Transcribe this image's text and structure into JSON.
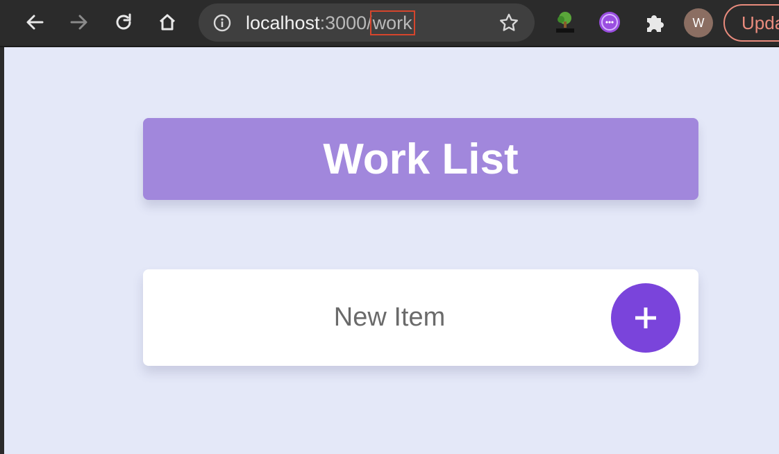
{
  "browser": {
    "url_host": "localhost",
    "url_port": ":3000/",
    "url_path": "work",
    "avatar_letter": "W",
    "update_label": "Update",
    "accent_color": "#e98b7d"
  },
  "page": {
    "title": "Work List",
    "new_item_placeholder": "New Item",
    "add_button_label": "+",
    "header_color": "#a187dc",
    "button_color": "#7a44db",
    "background_color": "#e4e8f8"
  }
}
